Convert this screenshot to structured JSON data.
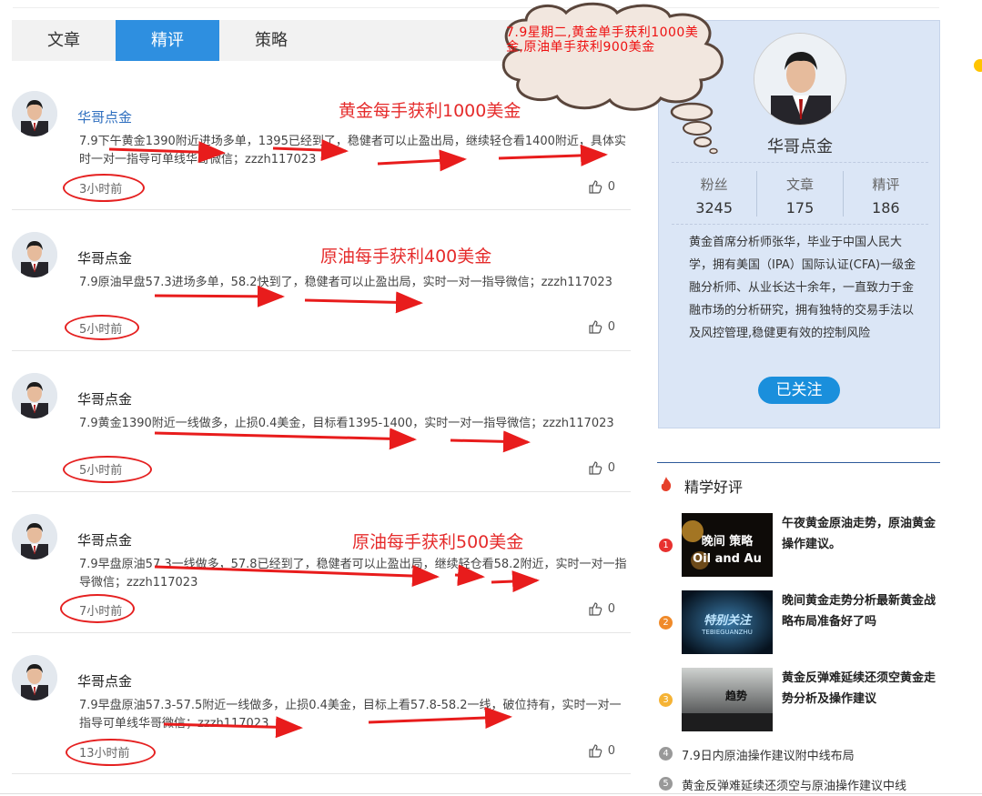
{
  "tabs": [
    {
      "label": "文章",
      "active": false
    },
    {
      "label": "精评",
      "active": true
    },
    {
      "label": "策略",
      "active": false
    }
  ],
  "posts": [
    {
      "author": "华哥点金",
      "content": "7.9下午黄金1390附近进场多单，1395已经到了，稳健者可以止盈出局，继续轻仓看1400附近，具体实时一对一指导可单线华哥微信；zzzh117023",
      "time": "3小时前",
      "likes": "0",
      "annotation": "黄金每手获利1000美金"
    },
    {
      "author": "华哥点金",
      "content": "7.9原油早盘57.3进场多单，58.2快到了，稳健者可以止盈出局，实时一对一指导微信；zzzh117023",
      "time": "5小时前",
      "likes": "0",
      "annotation": "原油每手获利400美金"
    },
    {
      "author": "华哥点金",
      "content": "7.9黄金1390附近一线做多，止损0.4美金，目标看1395-1400，实时一对一指导微信；zzzh117023",
      "time": "5小时前",
      "likes": "0",
      "annotation": ""
    },
    {
      "author": "华哥点金",
      "content": "7.9早盘原油57.3一线做多，57.8已经到了，稳健者可以止盈出局，继续轻仓看58.2附近，实时一对一指导微信；zzzh117023",
      "time": "7小时前",
      "likes": "0",
      "annotation": "原油每手获利500美金"
    },
    {
      "author": "华哥点金",
      "content": "7.9早盘原油57.3-57.5附近一线做多，止损0.4美金，目标上看57.8-58.2一线，破位持有，实时一对一指导可单线华哥微信；zzzh117023",
      "time": "13小时前",
      "likes": "0",
      "annotation": ""
    }
  ],
  "cloud_note": "7.9星期二,黄金单手获利1000美金,原油单手获利900美金",
  "profile": {
    "name": "华哥点金",
    "stats": [
      {
        "label": "粉丝",
        "value": "3245"
      },
      {
        "label": "文章",
        "value": "175"
      },
      {
        "label": "精评",
        "value": "186"
      }
    ],
    "bio": "黄金首席分析师张华，毕业于中国人民大学，拥有美国（IPA）国际认证(CFA)一级金融分析师、从业长达十余年，一直致力于金融市场的分析研究，拥有独特的交易手法以及风控管理,稳健更有效的控制风险",
    "follow_label": "已关注"
  },
  "hot": {
    "title": "精学好评",
    "items": [
      {
        "rank": "1",
        "title": "午夜黄金原油走势，原油黄金操作建议。",
        "thumb_text": "晚间 策略",
        "thumb_sub": "Oil and Au",
        "rank_color": "#e8312f"
      },
      {
        "rank": "2",
        "title": "晚间黄金走势分析最新黄金战略布局准备好了吗",
        "thumb_text": "特别关注",
        "thumb_sub": "TEBIEGUANZHU",
        "rank_color": "#f08a2a"
      },
      {
        "rank": "3",
        "title": "黄金反弹难延续还须空黄金走势分析及操作建议",
        "thumb_text": "趋势",
        "thumb_sub": "",
        "rank_color": "#f5b335"
      }
    ],
    "links": [
      {
        "rank": "4",
        "title": "7.9日内原油操作建议附中线布局"
      },
      {
        "rank": "5",
        "title": "黄金反弹难延续还须空与原油操作建议中线"
      }
    ]
  }
}
